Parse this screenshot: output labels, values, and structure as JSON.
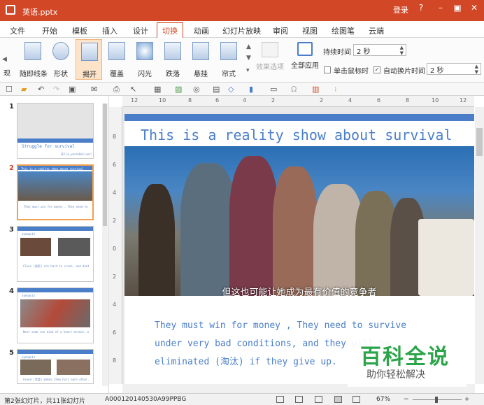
{
  "window": {
    "title": "英语.pptx",
    "login": "登录",
    "help": "?",
    "minimize": "–",
    "restore": "▣",
    "close": "✕"
  },
  "menu_tabs": [
    "文件",
    "开始",
    "模板",
    "插入",
    "设计",
    "切换",
    "动画",
    "幻灯片放映",
    "审阅",
    "视图",
    "绘图笔",
    "云端"
  ],
  "active_tab": "切换",
  "ribbon": {
    "transitions": [
      "随即线条",
      "形状",
      "揭开",
      "覆盖",
      "闪光",
      "跌落",
      "悬挂",
      "帘式"
    ],
    "partial_left": "现",
    "effect_options": "效果选项",
    "apply_all": "全部应用",
    "duration_label": "持续时间",
    "duration_value": "2 秒",
    "on_click_label": "单击鼠标时",
    "auto_advance_label": "自动换片时间",
    "auto_advance_value": "2 秒"
  },
  "slides": [
    {
      "num": "1",
      "title": "Struggle for survival",
      "subtitle": "【Ella_wordsDeliver】"
    },
    {
      "num": "2",
      "title": "This is a reality show about survival",
      "body": "They must win for money , They need to survive under very bad conditions, and they will be eliminated (淘汰) if they give up."
    },
    {
      "num": "3",
      "title": "synopsis",
      "body": "Clues (线索) are hard to crack, and death is everywhere."
    },
    {
      "num": "4",
      "title": "synopsis",
      "body": "Next some one died of a heart attack, and the survivors group..."
    },
    {
      "num": "5",
      "title": "synopsis",
      "body": "Greed (贪婪) makes them hurt each other..."
    }
  ],
  "main_slide": {
    "title": "This is a reality show about survival",
    "subtitle_overlay": "但这也可能让她成为最有价值的竞争者",
    "body_lines": [
      "They must win for money , They need to survive",
      "under very bad conditions, and they will be",
      "eliminated (淘汰) if they give up."
    ]
  },
  "ruler_h": [
    "12",
    "10",
    "8",
    "6",
    "4",
    "2",
    "2",
    "4",
    "6",
    "8",
    "10",
    "12"
  ],
  "ruler_v": [
    "8",
    "6",
    "4",
    "2",
    "0",
    "2",
    "4",
    "6",
    "8"
  ],
  "watermark": {
    "big": "百科全说",
    "small": "助你轻松解决"
  },
  "status": {
    "slide_info": "第2张幻灯片，共11张幻灯片",
    "code": "A000120140530A99PPBG",
    "zoom": "67%"
  },
  "colors": {
    "accent": "#d24726",
    "slide_blue": "#4a7ec9"
  }
}
